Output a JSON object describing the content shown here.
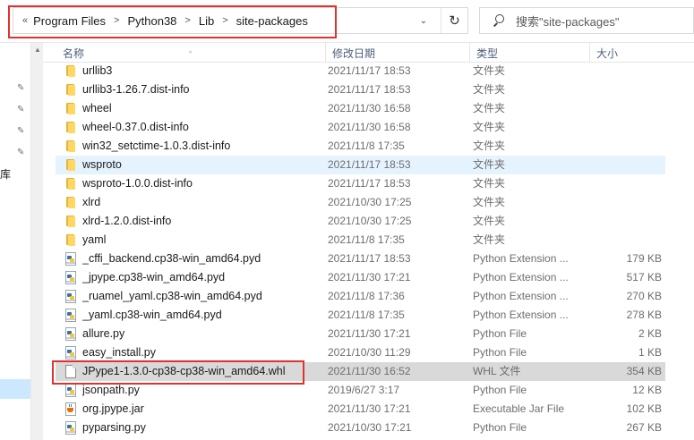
{
  "address": {
    "back_glyph": "«",
    "segments": [
      "Program Files",
      "Python38",
      "Lib",
      "site-packages"
    ],
    "refresh_glyph": "↻",
    "dropdown_glyph": "⌄"
  },
  "search": {
    "placeholder": "搜索\"site-packages\""
  },
  "nav": {
    "partial_label": "库"
  },
  "columns": {
    "name": "名称",
    "date": "修改日期",
    "type": "类型",
    "size": "大小"
  },
  "colors": {
    "highlight": "#e0322e",
    "selected_row": "#e5f3ff",
    "highlighted_row": "#d9d9d9"
  },
  "files": [
    {
      "icon": "folder-icon",
      "name": "urllib3",
      "date": "2021/11/17 18:53",
      "type": "文件夹",
      "size": ""
    },
    {
      "icon": "folder-icon",
      "name": "urllib3-1.26.7.dist-info",
      "date": "2021/11/17 18:53",
      "type": "文件夹",
      "size": ""
    },
    {
      "icon": "folder-icon",
      "name": "wheel",
      "date": "2021/11/30 16:58",
      "type": "文件夹",
      "size": ""
    },
    {
      "icon": "folder-icon",
      "name": "wheel-0.37.0.dist-info",
      "date": "2021/11/30 16:58",
      "type": "文件夹",
      "size": ""
    },
    {
      "icon": "folder-icon",
      "name": "win32_setctime-1.0.3.dist-info",
      "date": "2021/11/8 17:35",
      "type": "文件夹",
      "size": ""
    },
    {
      "icon": "folder-icon",
      "name": "wsproto",
      "date": "2021/11/17 18:53",
      "type": "文件夹",
      "size": "",
      "state": "selected"
    },
    {
      "icon": "folder-icon",
      "name": "wsproto-1.0.0.dist-info",
      "date": "2021/11/17 18:53",
      "type": "文件夹",
      "size": ""
    },
    {
      "icon": "folder-icon",
      "name": "xlrd",
      "date": "2021/10/30 17:25",
      "type": "文件夹",
      "size": ""
    },
    {
      "icon": "folder-icon",
      "name": "xlrd-1.2.0.dist-info",
      "date": "2021/10/30 17:25",
      "type": "文件夹",
      "size": ""
    },
    {
      "icon": "folder-icon",
      "name": "yaml",
      "date": "2021/11/8 17:35",
      "type": "文件夹",
      "size": ""
    },
    {
      "icon": "py-icon",
      "name": "_cffi_backend.cp38-win_amd64.pyd",
      "date": "2021/11/17 18:53",
      "type": "Python Extension ...",
      "size": "179 KB"
    },
    {
      "icon": "py-icon",
      "name": "_jpype.cp38-win_amd64.pyd",
      "date": "2021/11/30 17:21",
      "type": "Python Extension ...",
      "size": "517 KB"
    },
    {
      "icon": "py-icon",
      "name": "_ruamel_yaml.cp38-win_amd64.pyd",
      "date": "2021/11/8 17:36",
      "type": "Python Extension ...",
      "size": "270 KB"
    },
    {
      "icon": "py-icon",
      "name": "_yaml.cp38-win_amd64.pyd",
      "date": "2021/11/8 17:35",
      "type": "Python Extension ...",
      "size": "278 KB"
    },
    {
      "icon": "py-icon",
      "name": "allure.py",
      "date": "2021/11/30 17:21",
      "type": "Python File",
      "size": "2 KB"
    },
    {
      "icon": "py-icon",
      "name": "easy_install.py",
      "date": "2021/10/30 11:29",
      "type": "Python File",
      "size": "1 KB"
    },
    {
      "icon": "doc-icon",
      "name": "JPype1-1.3.0-cp38-cp38-win_amd64.whl",
      "date": "2021/11/30 16:52",
      "type": "WHL 文件",
      "size": "354 KB",
      "state": "highlighted"
    },
    {
      "icon": "py-icon",
      "name": "jsonpath.py",
      "date": "2019/6/27 3:17",
      "type": "Python File",
      "size": "12 KB"
    },
    {
      "icon": "jar-icon",
      "name": "org.jpype.jar",
      "date": "2021/11/30 17:21",
      "type": "Executable Jar File",
      "size": "102 KB"
    },
    {
      "icon": "py-icon",
      "name": "pyparsing.py",
      "date": "2021/10/30 17:21",
      "type": "Python File",
      "size": "267 KB"
    }
  ]
}
